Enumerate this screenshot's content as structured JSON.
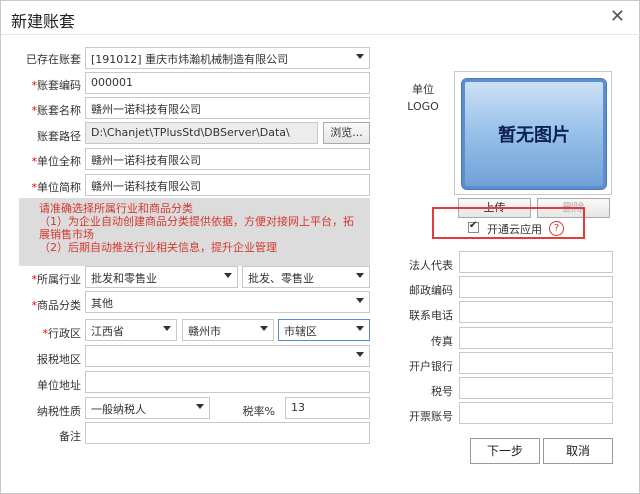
{
  "dialog": {
    "title": "新建账套",
    "close_glyph": "✕"
  },
  "form": {
    "existing": {
      "label": "已存在账套",
      "value": "[191012] 重庆市炜瀚机械制造有限公司"
    },
    "code": {
      "label": "账套编码",
      "value": "000001"
    },
    "name": {
      "label": "账套名称",
      "value": "赣州一诺科技有限公司"
    },
    "path": {
      "label": "账套路径",
      "value": "D:\\Chanjet\\TPlusStd\\DBServer\\Data\\",
      "browse": "浏览..."
    },
    "fullname": {
      "label": "单位全称",
      "value": "赣州一诺科技有限公司"
    },
    "shortname": {
      "label": "单位简称",
      "value": "赣州一诺科技有限公司"
    },
    "notice": {
      "line1": "请准确选择所属行业和商品分类",
      "line2": "（1）为企业自动创建商品分类提供依据，方便对接网上平台，拓展销售市场",
      "line3": "（2）后期自动推送行业相关信息，提升企业管理"
    },
    "industry": {
      "label": "所属行业",
      "value1": "批发和零售业",
      "value2": "批发、零售业"
    },
    "category": {
      "label": "商品分类",
      "value": "其他"
    },
    "region": {
      "label": "行政区",
      "province": "江西省",
      "city": "赣州市",
      "district": "市辖区"
    },
    "tax_region": {
      "label": "报税地区",
      "value": ""
    },
    "address": {
      "label": "单位地址",
      "value": ""
    },
    "tax_type": {
      "label": "纳税性质",
      "value": "一般纳税人"
    },
    "tax_rate": {
      "label": "税率%",
      "value": "13"
    },
    "remark": {
      "label": "备注",
      "value": ""
    }
  },
  "logo": {
    "label1": "单位",
    "label2": "LOGO",
    "placeholder": "暂无图片",
    "upload": "上传",
    "delete": "删除"
  },
  "cloud": {
    "label": "开通云应用",
    "checked": true,
    "help_glyph": "?"
  },
  "right_fields": [
    {
      "label": "法人代表",
      "value": ""
    },
    {
      "label": "邮政编码",
      "value": ""
    },
    {
      "label": "联系电话",
      "value": ""
    },
    {
      "label": "传真",
      "value": ""
    },
    {
      "label": "开户银行",
      "value": ""
    },
    {
      "label": "税号",
      "value": ""
    },
    {
      "label": "开票账号",
      "value": ""
    }
  ],
  "buttons": {
    "next": "下一步",
    "cancel": "取消"
  },
  "colors": {
    "required": "#e00000",
    "notice_text": "#d4382f",
    "highlight_box": "#e23b3b"
  }
}
